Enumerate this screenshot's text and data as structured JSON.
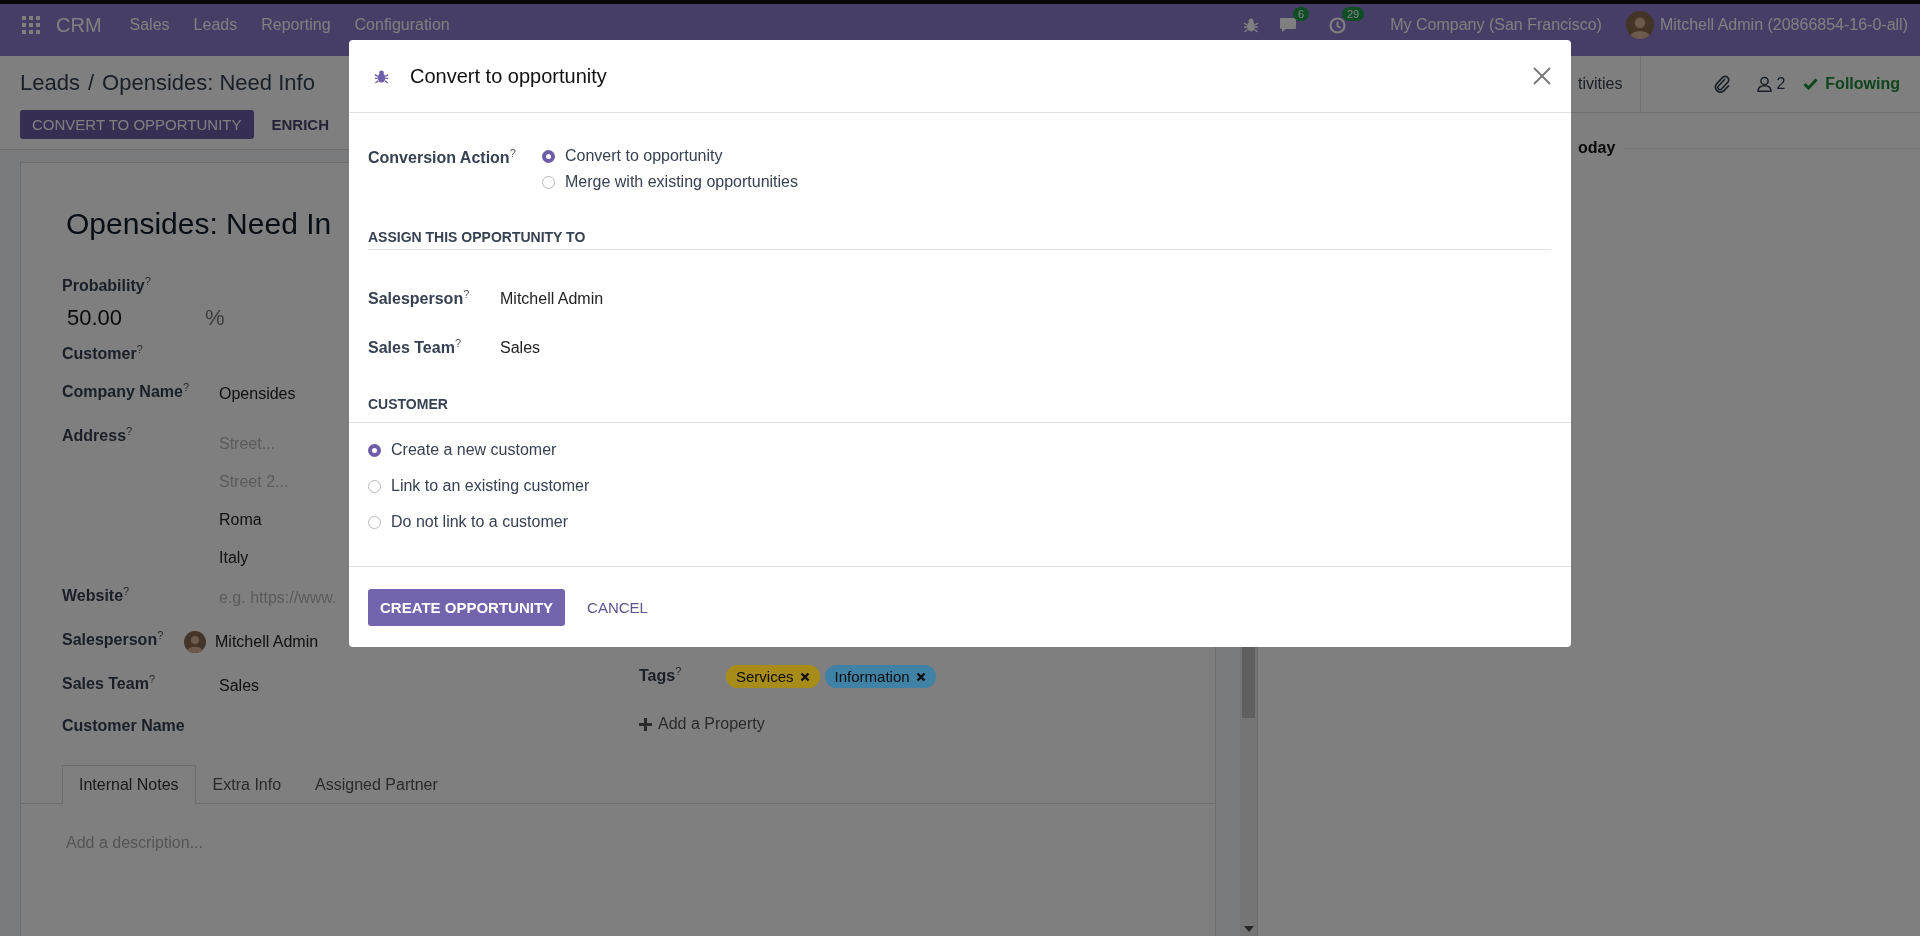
{
  "navbar": {
    "app": "CRM",
    "menus": [
      "Sales",
      "Leads",
      "Reporting",
      "Configuration"
    ],
    "messages_count": "6",
    "activities_count": "29",
    "company": "My Company (San Francisco)",
    "user": "Mitchell Admin (20866854-16-0-all)"
  },
  "breadcrumb": {
    "parent": "Leads",
    "separator": "/",
    "current": "Opensides: Need Info"
  },
  "actions": [
    {
      "label": "CONVERT TO OPPORTUNITY",
      "kind": "primary"
    },
    {
      "label": "ENRICH",
      "kind": "secondary"
    }
  ],
  "form": {
    "title": "Opensides: Need In",
    "probability": {
      "label": "Probability$^{?}$",
      "value": "50.00",
      "unit": "%"
    },
    "fields": [
      {
        "kind": "empty",
        "label": "Customer$^{?}$"
      },
      {
        "kind": "text",
        "label": "Company Name$^{?}$",
        "value": "Opensides"
      },
      {
        "kind": "address",
        "label": "Address$^{?}$",
        "lines": [
          {
            "placeholder": "Street..."
          },
          {
            "placeholder": "Street 2..."
          },
          {
            "value": "Roma"
          },
          {
            "value": "Italy"
          }
        ]
      },
      {
        "kind": "input",
        "label": "Website$^{?}$",
        "placeholder": "e.g. https://www."
      },
      {
        "kind": "user",
        "label": "Salesperson$^{?}$",
        "value": "Mitchell Admin"
      },
      {
        "kind": "text",
        "label": "Sales Team$^{?}$",
        "value": "Sales"
      },
      {
        "kind": "empty",
        "label": "Customer Name"
      }
    ],
    "tags": {
      "label": "Tags$^{?}$",
      "items": [
        {
          "label": "Services",
          "color": "#a88c1a"
        },
        {
          "label": "Information",
          "color": "#3f82a6"
        }
      ]
    },
    "add_property": "Add a Property",
    "tabs": [
      {
        "label": "Internal Notes",
        "selected": true
      },
      {
        "label": "Extra Info",
        "selected": false
      },
      {
        "label": "Assigned Partner",
        "selected": false
      }
    ],
    "notes_placeholder": "Add a description..."
  },
  "chatter": {
    "activities_button": "tivities",
    "followers_count": "2",
    "follow_label": "Following",
    "date_separator": "oday"
  },
  "dialog": {
    "title": "Convert to opportunity",
    "conversion_action": {
      "label": "Conversion Action$^{?}$",
      "options": [
        {
          "label": "Convert to opportunity",
          "selected": true
        },
        {
          "label": "Merge with existing opportunities",
          "selected": false
        }
      ]
    },
    "assign_heading": "ASSIGN THIS OPPORTUNITY TO",
    "fields": [
      {
        "label": "Salesperson$^{?}$",
        "value": "Mitchell Admin"
      },
      {
        "label": "Sales Team$^{?}$",
        "value": "Sales"
      }
    ],
    "customer_heading": "CUSTOMER",
    "customer_options": [
      {
        "label": "Create a new customer",
        "selected": true
      },
      {
        "label": "Link to an existing customer",
        "selected": false
      },
      {
        "label": "Do not link to a customer",
        "selected": false
      }
    ],
    "buttons": [
      {
        "label": "CREATE OPPORTUNITY",
        "kind": "primary"
      },
      {
        "label": "CANCEL",
        "kind": "link"
      }
    ]
  }
}
